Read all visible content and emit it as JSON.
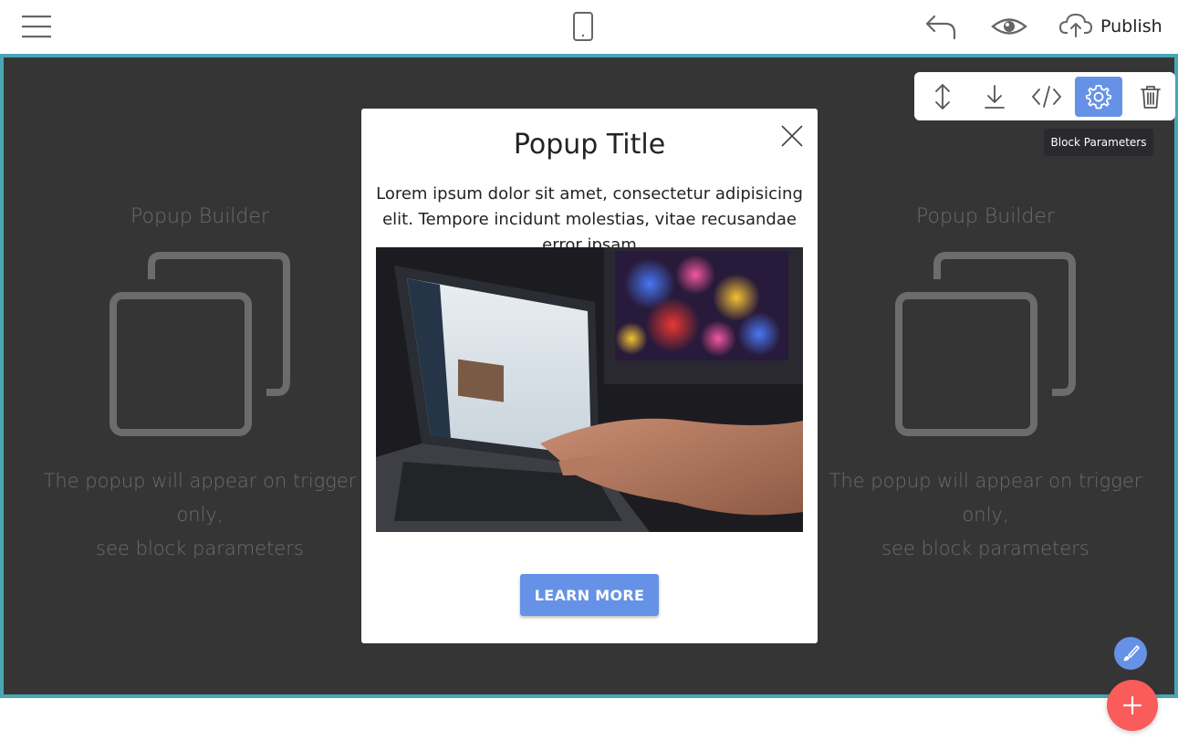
{
  "topbar": {
    "menu_icon": "hamburger-icon",
    "device_icon": "mobile-device-icon",
    "undo_icon": "undo-icon",
    "preview_icon": "eye-icon",
    "publish_icon": "cloud-upload-icon",
    "publish_label": "Publish"
  },
  "stage": {
    "background": "#353535",
    "border_color": "#49a6b5",
    "placeholders": [
      {
        "title": "Popup Builder",
        "line1": "The popup will appear on trigger only,",
        "line2": "see block parameters"
      },
      {
        "title": "Popup Builder",
        "line1": "The popup will appear on trigger only,",
        "line2": "see block parameters"
      }
    ]
  },
  "popup": {
    "title": "Popup Title",
    "text": "Lorem ipsum dolor sit amet, consectetur adipisicing elit. Tempore incidunt molestias, vitae recusandae error ipsam",
    "image_alt": "laptop photo",
    "cta_label": "LEARN MORE",
    "cta_color": "#6592e6"
  },
  "block_toolbar": {
    "buttons": [
      {
        "icon": "move-vertical-icon"
      },
      {
        "icon": "download-icon"
      },
      {
        "icon": "code-icon"
      },
      {
        "icon": "gear-icon",
        "active": true
      },
      {
        "icon": "trash-icon"
      }
    ],
    "tooltip": "Block Parameters"
  },
  "floating": {
    "brush_icon": "brush-icon",
    "add_icon": "plus-icon",
    "add_color": "#fa5b5b"
  }
}
